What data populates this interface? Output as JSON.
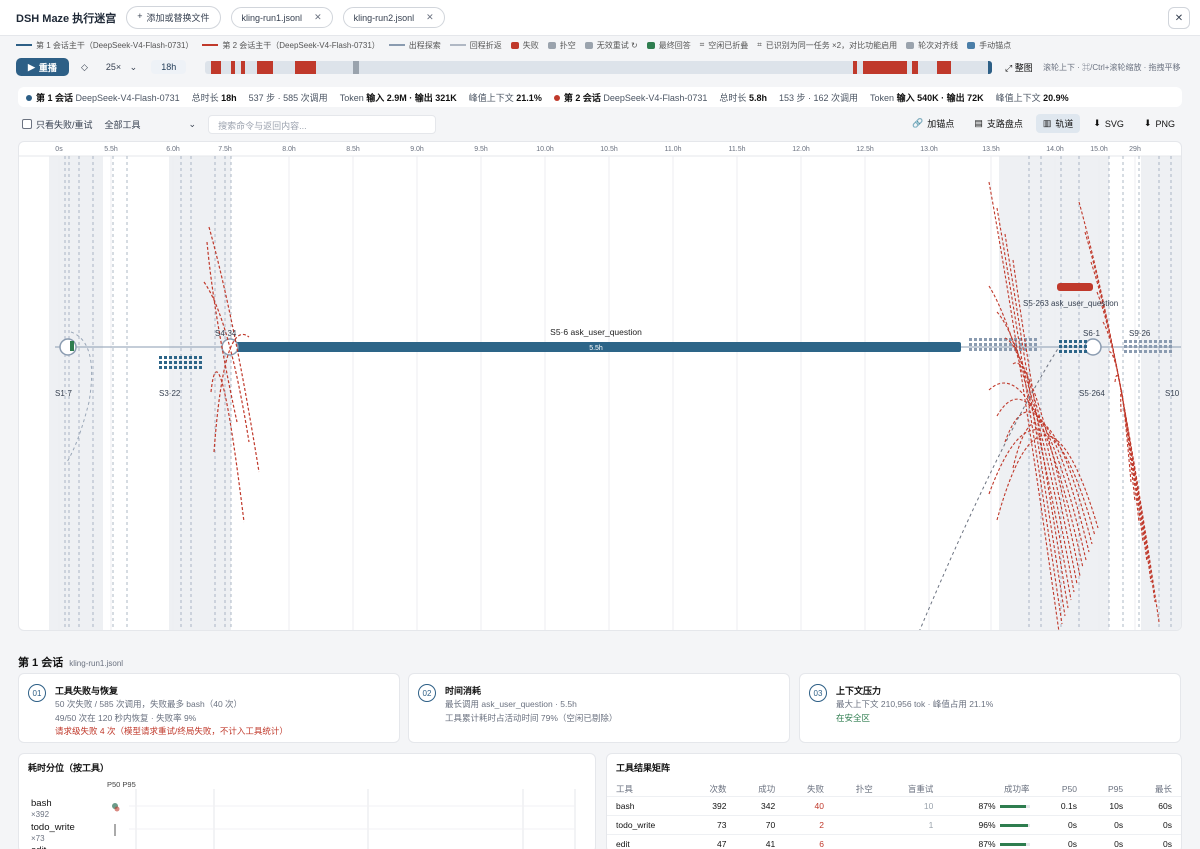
{
  "header": {
    "title": "DSH Maze 执行迷宫",
    "add_button": "添加或替换文件",
    "files": [
      "kling-run1.jsonl",
      "kling-run2.jsonl"
    ]
  },
  "legend": [
    {
      "label": "第 1 会话主干（DeepSeek-V4-Flash-0731）",
      "kind": "line",
      "color": "#2d5f86"
    },
    {
      "label": "第 2 会话主干（DeepSeek-V4-Flash-0731）",
      "kind": "line",
      "color": "#c0392b"
    },
    {
      "label": "出程探索",
      "kind": "line",
      "color": "#8a9bb0"
    },
    {
      "label": "回程折返",
      "kind": "line",
      "color": "#b0b8c4"
    },
    {
      "label": "失败",
      "kind": "square",
      "color": "#c0392b"
    },
    {
      "label": "扑空",
      "kind": "square",
      "color": "#9aa3ad"
    },
    {
      "label": "无效重试 ↻",
      "kind": "square",
      "color": "#9aa3ad"
    },
    {
      "label": "最终回答",
      "kind": "square",
      "color": "#2e7d4f"
    },
    {
      "label": "空闲已折叠",
      "kind": "text",
      "icon": "⌗"
    },
    {
      "label": "已识别为同一任务 ×2，对比功能启用",
      "kind": "text",
      "icon": "⌗"
    },
    {
      "label": "轮次对齐线",
      "kind": "square",
      "color": "#9aa3ad"
    },
    {
      "label": "手动锚点",
      "kind": "square",
      "color": "#4a7ea8"
    }
  ],
  "controls": {
    "play": "重播",
    "step_icon": "◇",
    "speed": "25×",
    "time": "18h",
    "overview": "整图",
    "hint": "滚轮上下 · ⌘/Ctrl+滚轮缩放 · 拖拽平移"
  },
  "stats": {
    "s1_label": "第 1 会话",
    "s1_model": "DeepSeek-V4-Flash-0731",
    "s1_duration_label": "总时长",
    "s1_duration": "18h",
    "s1_steps": "537 步 · 585 次调用",
    "s1_token_label": "Token",
    "s1_tokens": "输入 2.9M · 输出 321K",
    "s1_peak_label": "峰值上下文",
    "s1_peak": "21.1%",
    "s2_label": "第 2 会话",
    "s2_model": "DeepSeek-V4-Flash-0731",
    "s2_duration_label": "总时长",
    "s2_duration": "5.8h",
    "s2_steps": "153 步 · 162 次调用",
    "s2_token_label": "Token",
    "s2_tokens": "输入 540K · 输出 72K",
    "s2_peak_label": "峰值上下文",
    "s2_peak": "20.9%"
  },
  "filters": {
    "only_failed": "只看失败/重试",
    "tool_select": "全部工具",
    "search_placeholder": "搜索命令与返回内容..."
  },
  "view_tools": [
    "加锚点",
    "支路盘点",
    "轨道",
    "SVG",
    "PNG"
  ],
  "timeline": {
    "ticks": [
      "0s",
      "5.5h",
      "6.0h",
      "7.5h",
      "8.0h",
      "8.5h",
      "9.0h",
      "9.5h",
      "10.0h",
      "10.5h",
      "11.0h",
      "11.5h",
      "12.0h",
      "12.5h",
      "13.0h",
      "13.5h",
      "14.0h",
      "15.0h",
      "29h"
    ],
    "long_step_label": "S5·6 ask_user_question",
    "long_step_duration": "5.5h",
    "node_labels": [
      "S1·7",
      "S3·22",
      "S4·34",
      "S5·263 ask_user_question",
      "S6·1",
      "S9·26",
      "S5·264",
      "S10"
    ]
  },
  "session": {
    "title": "第 1 会话",
    "file": "kling-run1.jsonl"
  },
  "cards": [
    {
      "num": "01",
      "title": "工具失败与恢复",
      "lines": [
        "50 次失败 / 585 次调用，失败最多 bash（40 次）",
        "49/50 次在 120 秒内恢复 · 失败率 9%",
        "请求级失败 4 次（模型请求重试/终局失败，不计入工具统计）"
      ]
    },
    {
      "num": "02",
      "title": "时间消耗",
      "lines": [
        "最长调用 ask_user_question · 5.5h",
        "工具累计耗时占活动时间 79%（空闲已剔除）"
      ]
    },
    {
      "num": "03",
      "title": "上下文压力",
      "lines": [
        "最大上下文 210,956 tok · 峰值占用 21.1%",
        "在安全区"
      ]
    }
  ],
  "latency": {
    "title": "耗时分位（按工具）",
    "header": "P50 P95",
    "tools": [
      {
        "name": "bash",
        "count": "×392"
      },
      {
        "name": "todo_write",
        "count": "×73"
      },
      {
        "name": "edit",
        "count": ""
      }
    ]
  },
  "matrix": {
    "title": "工具结果矩阵",
    "columns": [
      "工具",
      "次数",
      "成功",
      "失败",
      "扑空",
      "盲重试",
      "成功率",
      "P50",
      "P95",
      "最长"
    ],
    "rows": [
      {
        "tool": "bash",
        "count": "392",
        "ok": "342",
        "fail": "40",
        "miss": "",
        "retry": "10",
        "rate": "87%",
        "rate_value": 0.87,
        "p50": "0.1s",
        "p95": "10s",
        "max": "60s"
      },
      {
        "tool": "todo_write",
        "count": "73",
        "ok": "70",
        "fail": "2",
        "miss": "",
        "retry": "1",
        "rate": "96%",
        "rate_value": 0.96,
        "p50": "0s",
        "p95": "0s",
        "max": "0s"
      },
      {
        "tool": "edit",
        "count": "47",
        "ok": "41",
        "fail": "6",
        "miss": "",
        "retry": "",
        "rate": "87%",
        "rate_value": 0.87,
        "p50": "0s",
        "p95": "0s",
        "max": "0s"
      }
    ]
  },
  "colors": {
    "primary": "#2d5f86",
    "failure": "#c0392b",
    "success": "#2e7d4f",
    "muted": "#9aa3ad"
  }
}
